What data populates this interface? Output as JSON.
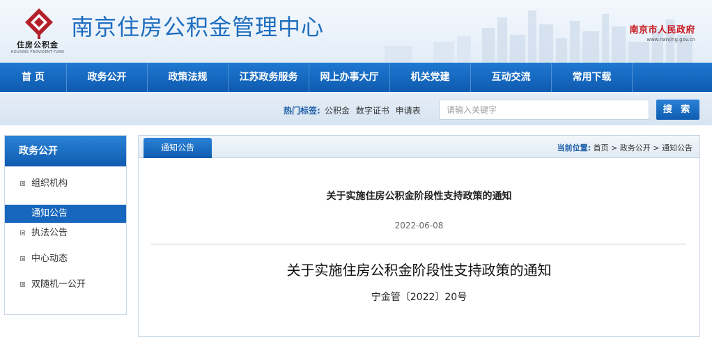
{
  "header": {
    "site_title": "南京住房公积金管理中心",
    "logo_cn": "住房公积金",
    "logo_en": "HOUSING PROVIDENT FUND",
    "gov_name": "南京市人民政府",
    "gov_url": "www.nanjing.gov.cn"
  },
  "nav": {
    "items": [
      "首 页",
      "政务公开",
      "政策法规",
      "江苏政务服务",
      "网上办事大厅",
      "机关党建",
      "互动交流",
      "常用下载"
    ]
  },
  "search": {
    "hot_label": "热门标签:",
    "hot_tags": [
      "公积金",
      "数字证书",
      "申请表"
    ],
    "placeholder": "请输入关键字",
    "button_label": "搜 索"
  },
  "sidebar": {
    "title": "政务公开",
    "items": [
      {
        "label": "组织机构",
        "active": false
      },
      {
        "label": "通知公告",
        "active": true
      },
      {
        "label": "执法公告",
        "active": false
      },
      {
        "label": "中心动态",
        "active": false
      },
      {
        "label": "双随机一公开",
        "active": false
      }
    ]
  },
  "content": {
    "tab_label": "通知公告",
    "breadcrumb": {
      "prefix": "当前位置:",
      "items": [
        "首页",
        "政务公开",
        "通知公告"
      ],
      "separator": ">"
    },
    "article_title": "关于实施住房公积金阶段性支持政策的通知",
    "article_date": "2022-06-08",
    "doc_title": "关于实施住房公积金阶段性支持政策的通知",
    "doc_number": "宁金管〔2022〕20号"
  },
  "colors": {
    "brand_blue": "#1e6dbf",
    "nav_blue": "#0e5bb0",
    "gov_red": "#c8171e",
    "logo_red": "#b3202a"
  }
}
